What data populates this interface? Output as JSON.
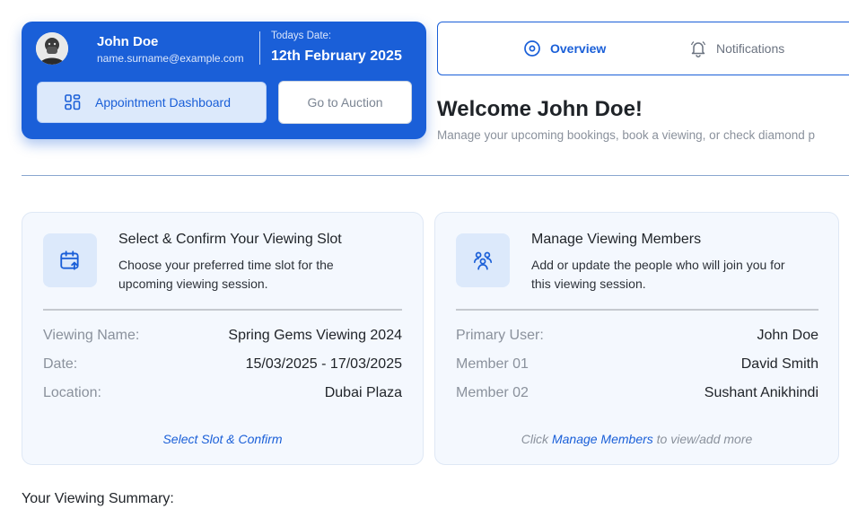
{
  "profile": {
    "name": "John Doe",
    "email": "name.surname@example.com",
    "date_label": "Todays Date:",
    "date_value": "12th February 2025",
    "avatar_icon": "user-photo"
  },
  "actions": {
    "dashboard_label": "Appointment Dashboard",
    "dashboard_icon": "grid-icon",
    "auction_label": "Go to Auction"
  },
  "tabs": [
    {
      "label": "Overview",
      "icon": "target-circle-icon",
      "active": true
    },
    {
      "label": "Notifications",
      "icon": "bell-icon",
      "active": false
    }
  ],
  "welcome": {
    "title": "Welcome John Doe!",
    "subtitle": "Manage your upcoming bookings, book a viewing, or check diamond p"
  },
  "slot_card": {
    "title": "Select & Confirm Your Viewing Slot",
    "description": "Choose your preferred time slot for the upcoming viewing session.",
    "icon": "calendar-upload-icon",
    "rows": [
      {
        "key": "Viewing Name:",
        "value": "Spring Gems Viewing 2024"
      },
      {
        "key": "Date:",
        "value": "15/03/2025 - 17/03/2025"
      },
      {
        "key": "Location:",
        "value": "Dubai Plaza"
      }
    ],
    "link_label": "Select Slot & Confirm"
  },
  "members_card": {
    "title": "Manage Viewing Members",
    "description": "Add or update the people who will join you for this viewing session.",
    "icon": "users-icon",
    "rows": [
      {
        "key": "Primary User:",
        "value": "John Doe"
      },
      {
        "key": "Member 01",
        "value": "David Smith"
      },
      {
        "key": "Member 02",
        "value": "Sushant Anikhindi"
      }
    ],
    "link_prefix": "Click",
    "link_label": "Manage Members",
    "link_suffix": "to view/add more"
  },
  "summary": {
    "title": "Your Viewing Summary:"
  },
  "colors": {
    "primary": "#1a5fd8",
    "card_bg": "#f4f8fe",
    "muted_text": "#8a919c"
  }
}
